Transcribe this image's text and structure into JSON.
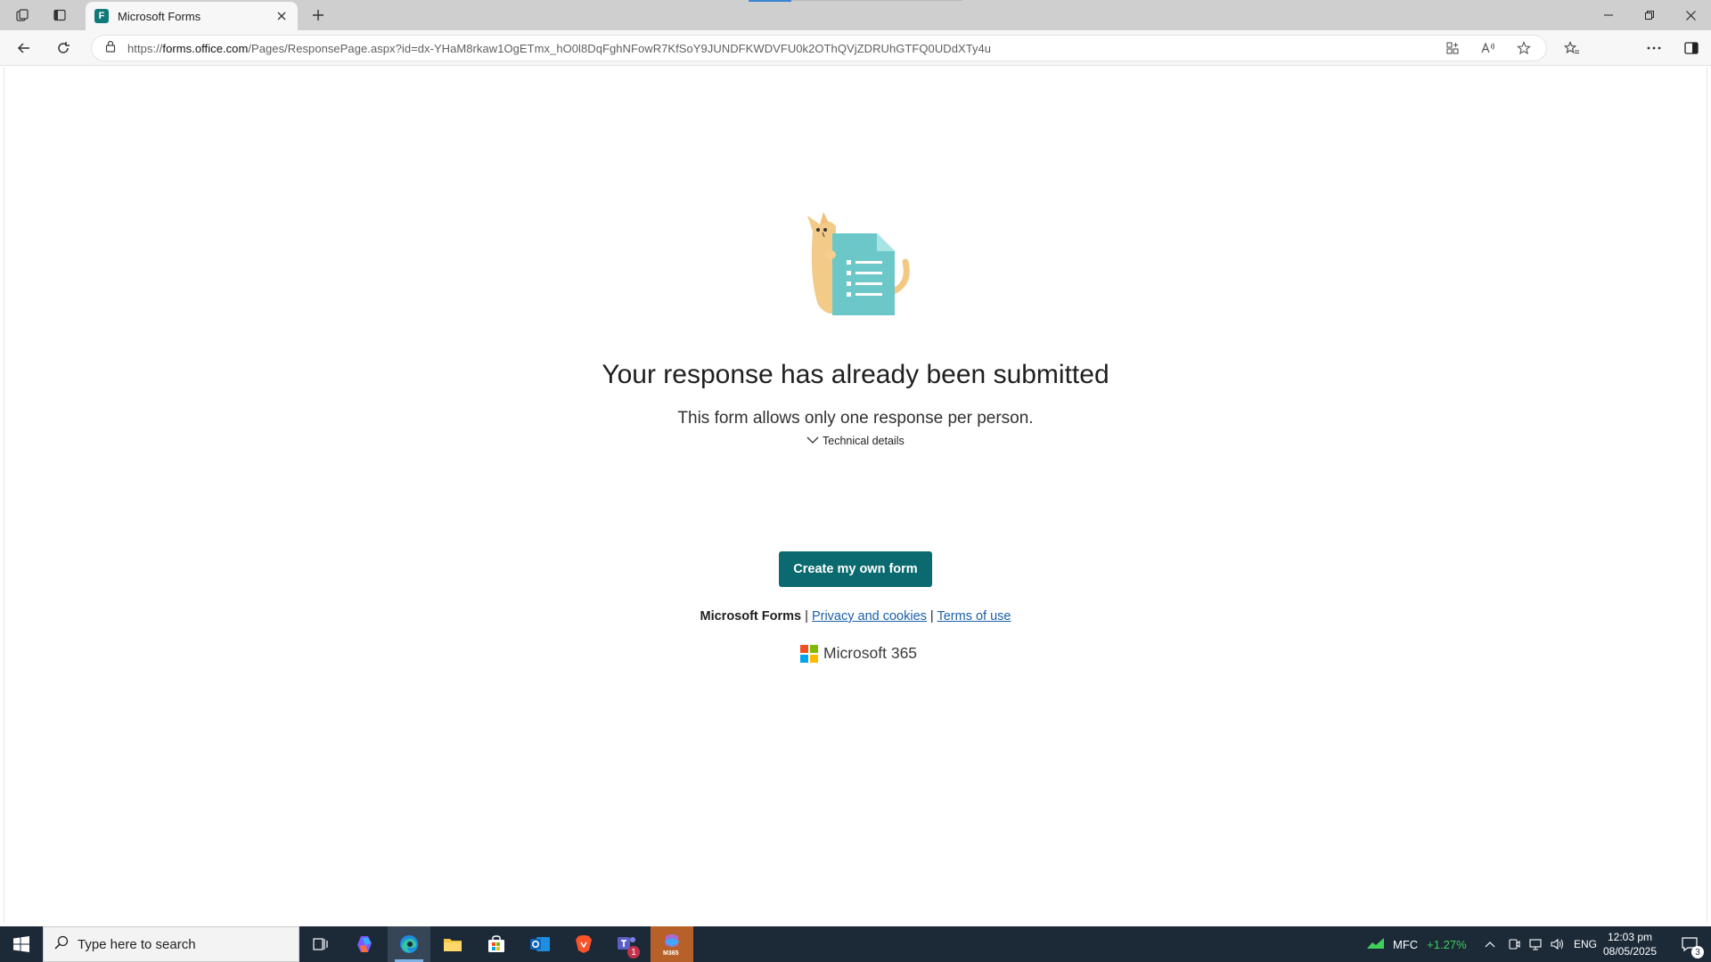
{
  "browser": {
    "tab_title": "Microsoft Forms",
    "tab_favicon_letter": "F",
    "url_prefix": "https://",
    "url_host": "forms.office.com",
    "url_path": "/Pages/ResponsePage.aspx?id=dx-YHaM8rkaw1OgETmx_hO0l8DqFghNFowR7KfSoY9JUNDFKWDVFU0k2OThQVjZDRUhGTFQ0UDdXTy4u"
  },
  "page": {
    "heading": "Your response has already been submitted",
    "subtext": "This form allows only one response per person.",
    "technical_details": "Technical details",
    "create_button": "Create my own form",
    "footer_brand": "Microsoft Forms",
    "separator": "|",
    "privacy_link": "Privacy and cookies",
    "terms_link": "Terms of use",
    "ms365_label": "Microsoft 365"
  },
  "taskbar": {
    "search_placeholder": "Type here to search",
    "ticker_symbol": "MFC",
    "ticker_change": "+1.27%",
    "language": "ENG",
    "time": "12:03 pm",
    "date": "08/05/2025",
    "notification_count": "3",
    "teams_badge": "1",
    "m365_label": "M365"
  },
  "colors": {
    "button_teal": "#0b6a6f",
    "link_blue": "#1a5fa8",
    "ticker_green": "#3fcf5a",
    "taskbar_bg": "#1c2a38"
  }
}
